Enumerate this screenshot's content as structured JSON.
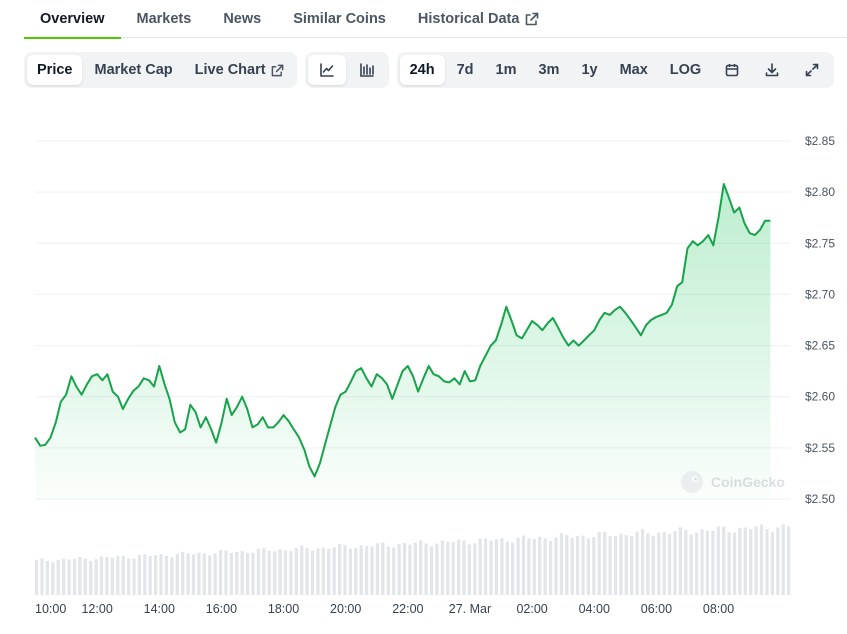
{
  "tabs": [
    {
      "label": "Overview",
      "active": true
    },
    {
      "label": "Markets",
      "active": false
    },
    {
      "label": "News",
      "active": false
    },
    {
      "label": "Similar Coins",
      "active": false
    },
    {
      "label": "Historical Data",
      "active": false,
      "external": true
    }
  ],
  "toolbar": {
    "metric_buttons": [
      {
        "label": "Price",
        "active": true
      },
      {
        "label": "Market Cap",
        "active": false
      },
      {
        "label": "Live Chart",
        "active": false,
        "external": true
      }
    ],
    "chart_type_icons": [
      "line-chart-icon",
      "candlestick-chart-icon"
    ],
    "range_buttons": [
      {
        "label": "24h",
        "active": true
      },
      {
        "label": "7d",
        "active": false
      },
      {
        "label": "1m",
        "active": false
      },
      {
        "label": "3m",
        "active": false
      },
      {
        "label": "1y",
        "active": false
      },
      {
        "label": "Max",
        "active": false
      },
      {
        "label": "LOG",
        "active": false
      }
    ],
    "action_icons": [
      "calendar-icon",
      "download-icon",
      "fullscreen-icon"
    ]
  },
  "watermark": "CoinGecko",
  "colors": {
    "line": "#16a34a",
    "accent": "#4bcc00",
    "volume": "#e2e5e9",
    "grid": "#eef0f3"
  },
  "chart_data": {
    "type": "area",
    "title": "",
    "xlabel": "",
    "ylabel": "",
    "ylim": [
      2.48,
      2.865
    ],
    "y_ticks": [
      2.85,
      2.8,
      2.75,
      2.7,
      2.65,
      2.6,
      2.55,
      2.5
    ],
    "y_tick_labels": [
      "$2.85",
      "$2.80",
      "$2.75",
      "$2.70",
      "$2.65",
      "$2.60",
      "$2.55",
      "$2.50"
    ],
    "x_tick_labels": [
      "10:00",
      "12:00",
      "14:00",
      "16:00",
      "18:00",
      "20:00",
      "22:00",
      "27. Mar",
      "02:00",
      "04:00",
      "06:00",
      "08:00"
    ],
    "x_tick_hours": [
      0,
      2,
      4,
      6,
      8,
      10,
      12,
      14,
      16,
      18,
      20,
      22
    ],
    "x_range_hours": [
      0,
      24.3
    ],
    "grid": true,
    "price_points": [
      [
        0.0,
        2.56
      ],
      [
        0.17,
        2.552
      ],
      [
        0.33,
        2.553
      ],
      [
        0.5,
        2.56
      ],
      [
        0.67,
        2.575
      ],
      [
        0.83,
        2.595
      ],
      [
        1.0,
        2.602
      ],
      [
        1.17,
        2.62
      ],
      [
        1.33,
        2.61
      ],
      [
        1.5,
        2.602
      ],
      [
        1.67,
        2.612
      ],
      [
        1.83,
        2.62
      ],
      [
        2.0,
        2.622
      ],
      [
        2.17,
        2.616
      ],
      [
        2.33,
        2.622
      ],
      [
        2.5,
        2.605
      ],
      [
        2.67,
        2.6
      ],
      [
        2.83,
        2.588
      ],
      [
        3.0,
        2.598
      ],
      [
        3.17,
        2.606
      ],
      [
        3.33,
        2.61
      ],
      [
        3.5,
        2.618
      ],
      [
        3.67,
        2.616
      ],
      [
        3.83,
        2.61
      ],
      [
        4.0,
        2.63
      ],
      [
        4.17,
        2.612
      ],
      [
        4.33,
        2.598
      ],
      [
        4.5,
        2.575
      ],
      [
        4.67,
        2.565
      ],
      [
        4.83,
        2.568
      ],
      [
        5.0,
        2.592
      ],
      [
        5.17,
        2.585
      ],
      [
        5.33,
        2.57
      ],
      [
        5.5,
        2.58
      ],
      [
        5.67,
        2.568
      ],
      [
        5.83,
        2.555
      ],
      [
        6.0,
        2.574
      ],
      [
        6.17,
        2.598
      ],
      [
        6.33,
        2.582
      ],
      [
        6.5,
        2.59
      ],
      [
        6.67,
        2.6
      ],
      [
        6.83,
        2.588
      ],
      [
        7.0,
        2.57
      ],
      [
        7.17,
        2.573
      ],
      [
        7.33,
        2.58
      ],
      [
        7.5,
        2.57
      ],
      [
        7.67,
        2.57
      ],
      [
        7.83,
        2.575
      ],
      [
        8.0,
        2.582
      ],
      [
        8.17,
        2.576
      ],
      [
        8.33,
        2.568
      ],
      [
        8.5,
        2.56
      ],
      [
        8.67,
        2.548
      ],
      [
        8.83,
        2.532
      ],
      [
        9.0,
        2.522
      ],
      [
        9.17,
        2.535
      ],
      [
        9.33,
        2.553
      ],
      [
        9.5,
        2.572
      ],
      [
        9.67,
        2.59
      ],
      [
        9.83,
        2.602
      ],
      [
        10.0,
        2.605
      ],
      [
        10.17,
        2.615
      ],
      [
        10.33,
        2.625
      ],
      [
        10.5,
        2.628
      ],
      [
        10.67,
        2.618
      ],
      [
        10.83,
        2.61
      ],
      [
        11.0,
        2.622
      ],
      [
        11.17,
        2.618
      ],
      [
        11.33,
        2.612
      ],
      [
        11.5,
        2.598
      ],
      [
        11.67,
        2.612
      ],
      [
        11.83,
        2.625
      ],
      [
        12.0,
        2.63
      ],
      [
        12.17,
        2.62
      ],
      [
        12.33,
        2.605
      ],
      [
        12.5,
        2.618
      ],
      [
        12.67,
        2.63
      ],
      [
        12.83,
        2.622
      ],
      [
        13.0,
        2.62
      ],
      [
        13.17,
        2.615
      ],
      [
        13.33,
        2.614
      ],
      [
        13.5,
        2.618
      ],
      [
        13.67,
        2.612
      ],
      [
        13.83,
        2.625
      ],
      [
        14.0,
        2.615
      ],
      [
        14.17,
        2.616
      ],
      [
        14.33,
        2.63
      ],
      [
        14.5,
        2.64
      ],
      [
        14.67,
        2.65
      ],
      [
        14.83,
        2.655
      ],
      [
        15.0,
        2.67
      ],
      [
        15.17,
        2.688
      ],
      [
        15.33,
        2.675
      ],
      [
        15.5,
        2.66
      ],
      [
        15.67,
        2.657
      ],
      [
        15.83,
        2.665
      ],
      [
        16.0,
        2.674
      ],
      [
        16.17,
        2.67
      ],
      [
        16.33,
        2.665
      ],
      [
        16.5,
        2.672
      ],
      [
        16.67,
        2.677
      ],
      [
        16.83,
        2.668
      ],
      [
        17.0,
        2.658
      ],
      [
        17.17,
        2.65
      ],
      [
        17.33,
        2.655
      ],
      [
        17.5,
        2.65
      ],
      [
        17.67,
        2.655
      ],
      [
        17.83,
        2.66
      ],
      [
        18.0,
        2.665
      ],
      [
        18.17,
        2.675
      ],
      [
        18.33,
        2.682
      ],
      [
        18.5,
        2.68
      ],
      [
        18.67,
        2.685
      ],
      [
        18.83,
        2.688
      ],
      [
        19.0,
        2.682
      ],
      [
        19.17,
        2.675
      ],
      [
        19.33,
        2.668
      ],
      [
        19.5,
        2.66
      ],
      [
        19.67,
        2.67
      ],
      [
        19.83,
        2.675
      ],
      [
        20.0,
        2.678
      ],
      [
        20.17,
        2.68
      ],
      [
        20.33,
        2.682
      ],
      [
        20.5,
        2.69
      ],
      [
        20.67,
        2.708
      ],
      [
        20.83,
        2.712
      ],
      [
        21.0,
        2.745
      ],
      [
        21.17,
        2.752
      ],
      [
        21.33,
        2.748
      ],
      [
        21.5,
        2.752
      ],
      [
        21.67,
        2.758
      ],
      [
        21.83,
        2.748
      ],
      [
        22.0,
        2.775
      ],
      [
        22.17,
        2.808
      ],
      [
        22.33,
        2.795
      ],
      [
        22.5,
        2.78
      ],
      [
        22.67,
        2.785
      ],
      [
        22.83,
        2.77
      ],
      [
        23.0,
        2.76
      ],
      [
        23.17,
        2.758
      ],
      [
        23.33,
        2.763
      ],
      [
        23.5,
        2.772
      ],
      [
        23.67,
        2.772
      ]
    ],
    "volume_relative": {
      "start": 0.36,
      "end": 0.72,
      "bar_count": 140
    }
  }
}
